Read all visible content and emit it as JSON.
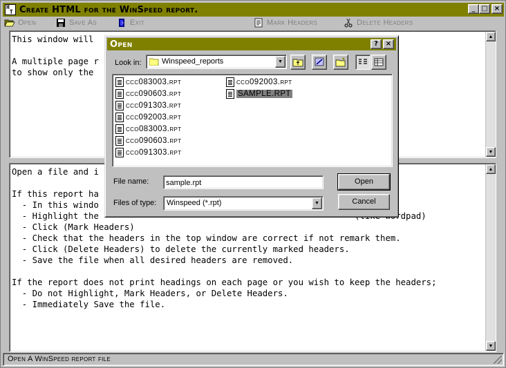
{
  "main_window": {
    "title": "Create HTML for the WinSpeed report.",
    "caption_buttons": {
      "minimize": "_",
      "maximize": "□",
      "close": "×"
    }
  },
  "toolbar": {
    "open": {
      "label": "Open",
      "icon": "open-folder-icon"
    },
    "save_as": {
      "label": "Save As",
      "icon": "floppy-disk-icon"
    },
    "exit": {
      "label": "Exit",
      "icon": "exit-door-icon"
    },
    "mark_headers": {
      "label": "Mark Headers",
      "icon": "document-mark-icon"
    },
    "delete_headers": {
      "label": "Delete Headers",
      "icon": "scissors-icon"
    }
  },
  "top_pane": {
    "lines": [
      "This window will                                       files.",
      "",
      "A multiple page r",
      "to show only the "
    ]
  },
  "bottom_pane": {
    "lines": [
      "Open a file and i",
      "",
      "If this report ha",
      "  - In this windo",
      "  - Highlight the                                                  (like wordpad)",
      "  - Click (Mark Headers)",
      "  - Check that the headers in the top window are correct if not remark them.",
      "  - Click (Delete Headers) to delete the currently marked headers.",
      "  - Save the file when all desired headers are removed.",
      "",
      "If the report does not print headings on each page or you wish to keep the headers;",
      "  - Do not Highlight, Mark Headers, or Delete Headers.",
      "  - Immediately Save the file."
    ]
  },
  "status_bar": {
    "text": "Open A WinSpeed report file"
  },
  "open_dialog": {
    "title": "Open",
    "help_button": "?",
    "close_button": "×",
    "look_in_label": "Look in:",
    "look_in_value": "Winspeed_reports",
    "files": [
      {
        "name": "ccc083003.rpt",
        "selected": false
      },
      {
        "name": "ccc090603.rpt",
        "selected": false
      },
      {
        "name": "ccc091303.rpt",
        "selected": false
      },
      {
        "name": "ccc092003.rpt",
        "selected": false
      },
      {
        "name": "cco083003.rpt",
        "selected": false
      },
      {
        "name": "cco090603.rpt",
        "selected": false
      },
      {
        "name": "cco091303.rpt",
        "selected": false
      },
      {
        "name": "cco092003.rpt",
        "selected": false
      },
      {
        "name": "SAMPLE.RPT",
        "selected": true
      }
    ],
    "file_name_label": "File name:",
    "file_name_value": "sample.rpt",
    "files_of_type_label": "Files of type:",
    "files_of_type_value": "Winspeed (*.rpt)",
    "open_button": "Open",
    "cancel_button": "Cancel"
  }
}
